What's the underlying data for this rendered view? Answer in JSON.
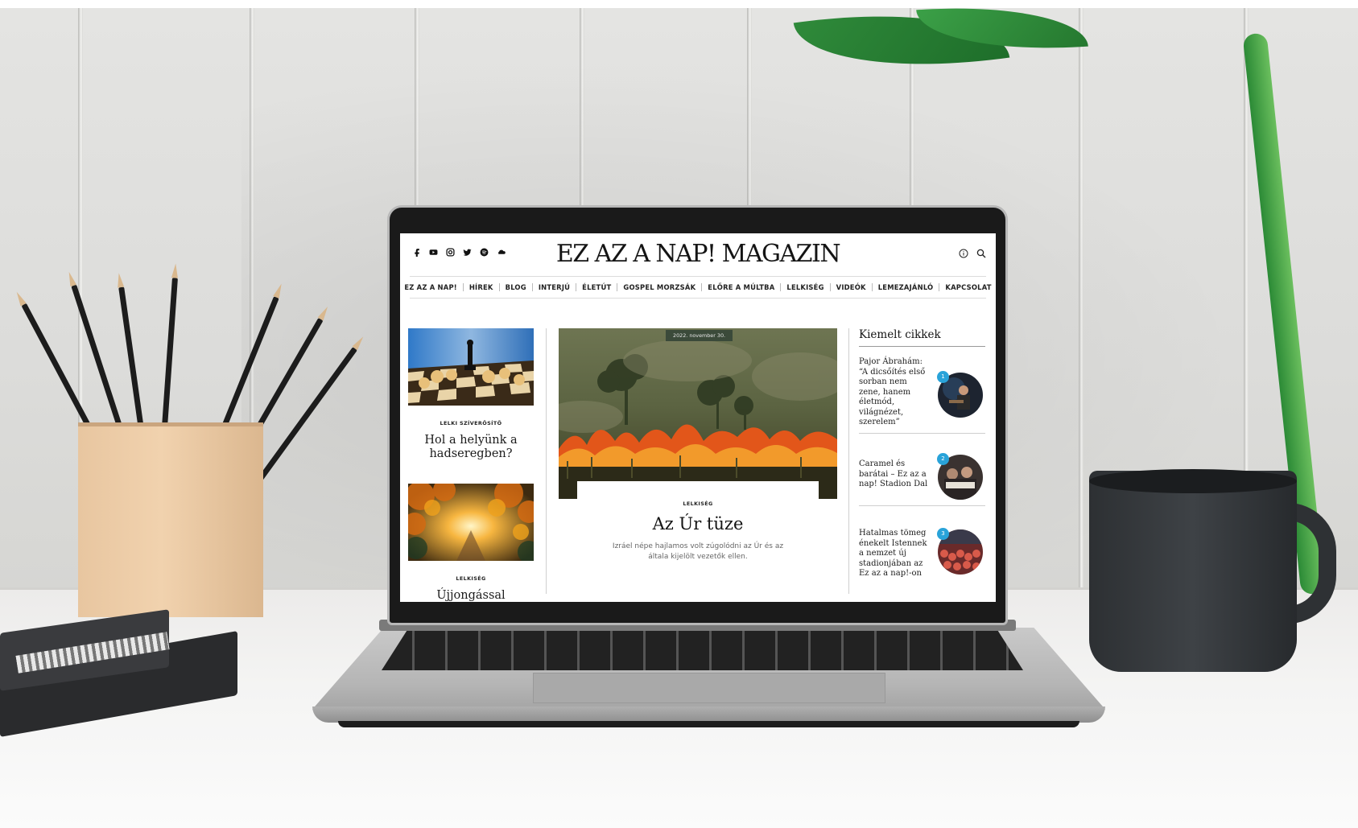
{
  "site": {
    "title": "EZ AZ A NAP! MAGAZIN",
    "social_icons": [
      "facebook-icon",
      "youtube-icon",
      "instagram-icon",
      "twitter-icon",
      "spotify-icon",
      "soundcloud-icon"
    ],
    "header_icons": [
      "info-icon",
      "search-icon"
    ]
  },
  "nav": {
    "items": [
      "EZ AZ A NAP!",
      "HÍREK",
      "BLOG",
      "INTERJÚ",
      "ÉLETÚT",
      "GOSPEL MORZSÁK",
      "ELŐRE A MÚLTBA",
      "LELKISÉG",
      "VIDEÓK",
      "LEMEZAJÁNLÓ",
      "KAPCSOLAT"
    ]
  },
  "left_column": {
    "cards": [
      {
        "category": "LELKI SZÍVERŐSÍTŐ",
        "title": "Hol a helyünk a hadseregben?"
      },
      {
        "category": "LELKISÉG",
        "title": "Újjongással"
      }
    ]
  },
  "hero": {
    "date": "2022. november 30.",
    "category": "LELKISÉG",
    "title": "Az Úr tüze",
    "excerpt": "Izráel népe hajlamos volt zúgolódni az Úr és az általa kijelölt vezetők ellen."
  },
  "featured": {
    "heading": "Kiemelt cikkek",
    "items": [
      {
        "number": "1",
        "title": "Pajor Ábrahám: “A dicsőítés első sorban nem zene, hanem életmód, világnézet, szerelem”"
      },
      {
        "number": "2",
        "title": "Caramel és barátai – Ez az a nap! Stadion Dal"
      },
      {
        "number": "3",
        "title": "Hatalmas tömeg énekelt Istennek a nemzet új stadionjában az Ez az a nap!-on"
      }
    ]
  },
  "colors": {
    "accent_badge": "#29a3d9",
    "mug": "#2e3134",
    "leaves": "#2f8a3a"
  }
}
